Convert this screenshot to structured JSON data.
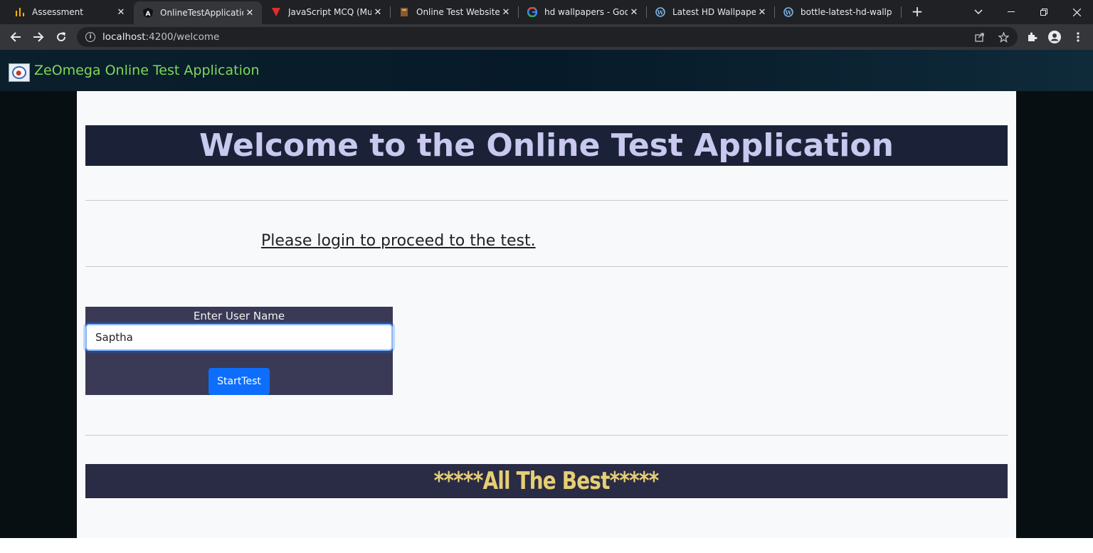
{
  "browser": {
    "tabs": [
      {
        "title": "Assessment",
        "icon": "bar-chart-icon",
        "active": false
      },
      {
        "title": "OnlineTestApplication",
        "icon": "angular-icon",
        "active": true
      },
      {
        "title": "JavaScript MCQ (Multi",
        "icon": "vlogo-icon",
        "active": false
      },
      {
        "title": "Online Test Website Te",
        "icon": "book-icon",
        "active": false
      },
      {
        "title": "hd wallpapers - Googl",
        "icon": "google-icon",
        "active": false
      },
      {
        "title": "Latest HD Wallpaper,",
        "icon": "wordpress-icon",
        "active": false
      },
      {
        "title": "bottle-latest-hd-wallp",
        "icon": "wordpress-icon",
        "active": false
      }
    ],
    "url_host": "localhost",
    "url_path": ":4200/welcome"
  },
  "app": {
    "brand": "ZeOmega Online Test Application",
    "heading": "Welcome to the Online Test Application",
    "login_prompt": "Please login to proceed to the test.",
    "username_label": "Enter User Name",
    "username_value": "Saptha",
    "start_button": "StartTest",
    "footer_text": "*****All The Best*****"
  },
  "colors": {
    "heading_bg": "#1b2238",
    "heading_text": "#c9c8ee",
    "brand_text": "#7ed957",
    "button_bg": "#0d6efd",
    "footer_text": "#e6cf74"
  }
}
